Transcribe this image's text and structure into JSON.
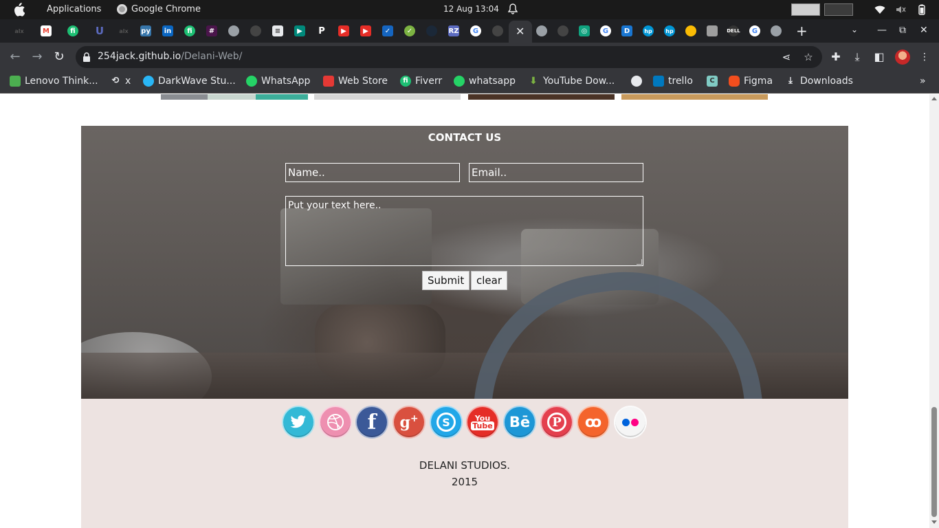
{
  "os": {
    "applications": "Applications",
    "active_app": "Google Chrome",
    "clock": "12 Aug  13:04"
  },
  "browser": {
    "url_host": "254jack.github.io",
    "url_path": "/Delani-Web/",
    "tab_close": "✕",
    "new_tab": "+"
  },
  "bookmarks": [
    {
      "label": "Lenovo Think...",
      "icon": "lenovo-icon",
      "color": "#4caf50"
    },
    {
      "label": "x",
      "icon": "history-icon",
      "color": "#9aa0a6"
    },
    {
      "label": "DarkWave Stu...",
      "icon": "darkwave-icon",
      "color": "#29b6f6"
    },
    {
      "label": "WhatsApp",
      "icon": "whatsapp-icon",
      "color": "#25d366"
    },
    {
      "label": "Web Store",
      "icon": "webstore-icon",
      "color": "#e53935"
    },
    {
      "label": "Fiverr",
      "icon": "fiverr-icon",
      "color": "#1dbf73"
    },
    {
      "label": "whatsapp",
      "icon": "whatsapp-icon",
      "color": "#25d366"
    },
    {
      "label": "YouTube Dow...",
      "icon": "download-arrow-icon",
      "color": "#7cb342"
    },
    {
      "label": "",
      "icon": "globe-icon",
      "color": "#e8eaed"
    },
    {
      "label": "trello",
      "icon": "trello-icon",
      "color": "#0079bf"
    },
    {
      "label": "",
      "icon": "bookmark-c-icon",
      "color": "#80cbc4"
    },
    {
      "label": "Figma",
      "icon": "figma-icon",
      "color": "#f24e1e"
    },
    {
      "label": "Downloads",
      "icon": "download-icon",
      "color": "#e8eaed"
    }
  ],
  "contact": {
    "title": "CONTACT US",
    "name_placeholder": "Name..",
    "email_placeholder": "Email..",
    "message_placeholder": "Put your text here..",
    "submit_label": "Submit",
    "clear_label": "clear"
  },
  "social": [
    {
      "name": "twitter",
      "glyph": "🐦",
      "color": "#33b9d6"
    },
    {
      "name": "dribbble",
      "glyph": "◎",
      "color": "#ee8fb0"
    },
    {
      "name": "facebook",
      "glyph": "f",
      "color": "#3b5998"
    },
    {
      "name": "google-plus",
      "glyph": "g+",
      "color": "#d9503f"
    },
    {
      "name": "skype",
      "glyph": "S",
      "color": "#21a7e8"
    },
    {
      "name": "youtube",
      "glyph": "You Tube",
      "color": "#e52d27"
    },
    {
      "name": "behance",
      "glyph": "Bē",
      "color": "#1d97d6"
    },
    {
      "name": "pinterest",
      "glyph": "P",
      "color": "#e4404e"
    },
    {
      "name": "stumbleupon",
      "glyph": "su",
      "color": "#f4642c"
    },
    {
      "name": "flickr",
      "glyph": "●●",
      "color": "#f5f5f5"
    }
  ],
  "footer": {
    "studio": "DELANI STUDIOS.",
    "year": "2015"
  }
}
